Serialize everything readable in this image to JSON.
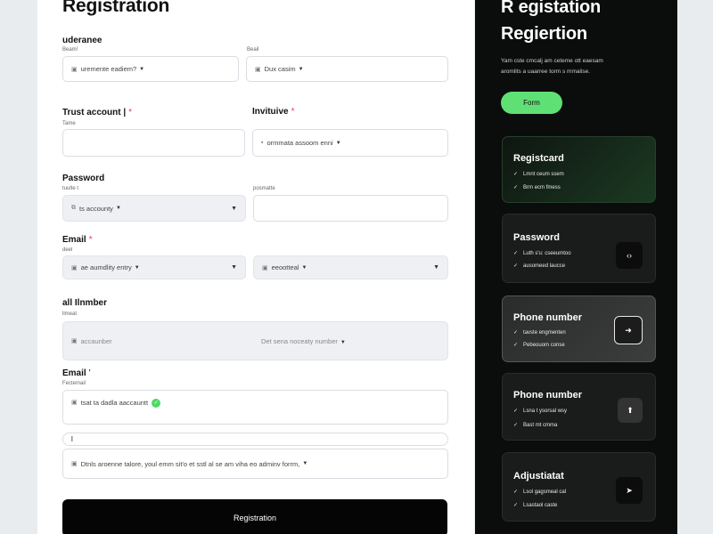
{
  "form": {
    "title": "Registration",
    "sec1": {
      "label": "uderanee",
      "hint_left": "Beam!",
      "hint_right": "Beail",
      "f1": {
        "icon": "▣",
        "value": "uremente eadiem?"
      },
      "f2": {
        "icon": "▣",
        "value": "Dux casim"
      }
    },
    "sec2": {
      "label_left": "Trust account |",
      "label_right": "Invituive",
      "hint": "Tame",
      "f2": {
        "icon": "▪",
        "value": "ormmata assoom enni"
      }
    },
    "sec3": {
      "label": "Password",
      "hint_left": "tuulte t",
      "hint_right": "posmatte",
      "f1": {
        "icon": "⧉",
        "value": "ts accounty"
      }
    },
    "sec4": {
      "label": "Email",
      "hint": "deel",
      "f1": {
        "icon": "▣",
        "value": "ae aumdlity entry"
      },
      "f2": {
        "icon": "▣",
        "value": "eeootteal"
      }
    },
    "sec5": {
      "label": "all Ilnmber",
      "hint": "llmeat",
      "f1": {
        "icon": "▣",
        "value": "accaunber"
      },
      "f2": {
        "value": "Det sena noceaty number"
      }
    },
    "sec6": {
      "label": "Email",
      "hint": "Fectemail",
      "f1": {
        "icon": "▣",
        "value": "tsat ta dadla aaccauntt"
      },
      "f2": {
        "value": "l"
      },
      "f3": {
        "icon": "▣",
        "value": "Dtnls aroenne talore, youl emm sit'o et sstl al se am viha eo adminv forrm,"
      }
    },
    "submit_label": "Registration"
  },
  "side": {
    "title_line1": "R egistation",
    "title_line2": "Regiertion",
    "desc_line1": "Yam cste cmcalj am ceteme ott eaesam",
    "desc_line2": "aromlits a uaarree torm s mmalise.",
    "button_label": "Form",
    "cards": [
      {
        "title": "Registcard",
        "line1": "Lmnt ceum ssem",
        "line2": "Brm ecm fmess"
      },
      {
        "title": "Password",
        "line1": "Luth s'u: cseeumtoo",
        "line2": "ausomeed laucce",
        "icon": "‹›"
      },
      {
        "title": "Phone number",
        "line1": "tavste engmenten",
        "line2": "Pebeouom conse",
        "icon": "➜"
      },
      {
        "title": "Phone number",
        "line1": "Lsna t ysorsal wsy",
        "line2": "Bast mt cmma",
        "icon": "⬆"
      },
      {
        "title": "Adjustiatat",
        "line1": "Lsol gagsmeal cal",
        "line2": "Lsastaol caste",
        "icon": "➤"
      }
    ]
  },
  "colors": {
    "accent_green": "#5fe074",
    "dark_panel": "#0b0c0c",
    "required": "#e0454c"
  }
}
